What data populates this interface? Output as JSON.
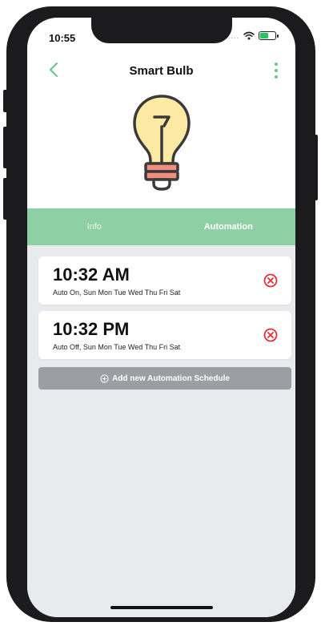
{
  "status_bar": {
    "time": "10:55",
    "signal": "....",
    "icons": [
      "wifi-icon",
      "battery-icon"
    ]
  },
  "nav": {
    "title": "Smart Bulb",
    "back_icon": "chevron-left-icon",
    "menu_icon": "more-vertical-icon"
  },
  "hero": {
    "icon": "lightbulb-icon"
  },
  "tabs": [
    {
      "label": "Info",
      "active": false
    },
    {
      "label": "Automation",
      "active": true
    }
  ],
  "schedules": [
    {
      "time": "10:32 AM",
      "description": "Auto On, Sun Mon Tue Wed Thu Fri Sat"
    },
    {
      "time": "10:32 PM",
      "description": "Auto Off, Sun Mon Tue Wed Thu Fri Sat"
    }
  ],
  "add_button": {
    "label": "Add new Automation Schedule",
    "icon": "plus-circle-icon"
  },
  "colors": {
    "accent": "#6cc58e",
    "tab_bar": "#8fcfa4",
    "content_bg": "#e7ebee",
    "delete": "#e0303a",
    "add_button_bg": "#9b9ea3",
    "bulb_fill": "#fbe9a4",
    "bulb_base": "#f08f7e"
  }
}
